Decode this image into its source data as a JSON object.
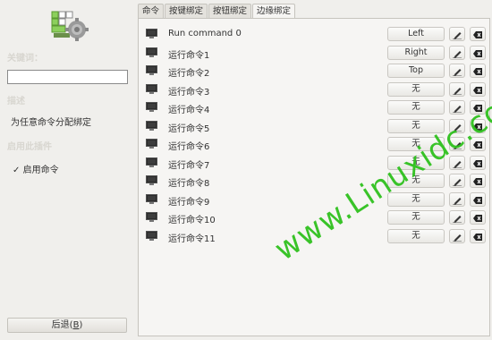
{
  "left": {
    "label_keybinding": "关键词：",
    "label_description": "描述",
    "description_text": "为任意命令分配绑定",
    "label_enable_plugin": "启用此插件",
    "enable_checkbox_label": "启用命令",
    "enable_checked": true,
    "search_value": "",
    "back_button": {
      "text": "后退(",
      "mnemonic": "B",
      "suffix": ")"
    }
  },
  "tabs": [
    {
      "label": "命令"
    },
    {
      "label": "按键绑定"
    },
    {
      "label": "按钮绑定"
    },
    {
      "label": "边缘绑定",
      "active": true
    }
  ],
  "commands": [
    {
      "name": "Run command 0",
      "binding": "Left"
    },
    {
      "name": "运行命令1",
      "binding": "Right"
    },
    {
      "name": "运行命令2",
      "binding": "Top"
    },
    {
      "name": "运行命令3",
      "binding": "无"
    },
    {
      "name": "运行命令4",
      "binding": "无"
    },
    {
      "name": "运行命令5",
      "binding": "无"
    },
    {
      "name": "运行命令6",
      "binding": "无"
    },
    {
      "name": "运行命令7",
      "binding": "无"
    },
    {
      "name": "运行命令8",
      "binding": "无"
    },
    {
      "name": "运行命令9",
      "binding": "无"
    },
    {
      "name": "运行命令10",
      "binding": "无"
    },
    {
      "name": "运行命令11",
      "binding": "无"
    }
  ],
  "icons": {
    "row": "monitor-icon",
    "edit": "edit-pencil-icon",
    "clear": "clear-backspace-icon",
    "logo": "settings-gear-icon"
  },
  "watermark": "www.Linuxidc.com",
  "colors": {
    "watermark": "#2fc11e",
    "background": "#f0efec"
  }
}
